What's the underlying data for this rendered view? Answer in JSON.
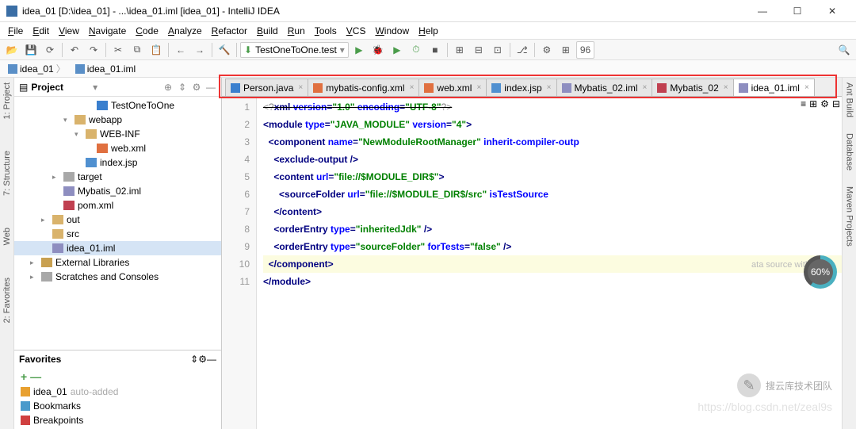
{
  "window": {
    "title": "idea_01 [D:\\idea_01] - ...\\idea_01.iml [idea_01] - IntelliJ IDEA"
  },
  "menu": [
    "File",
    "Edit",
    "View",
    "Navigate",
    "Code",
    "Analyze",
    "Refactor",
    "Build",
    "Run",
    "Tools",
    "VCS",
    "Window",
    "Help"
  ],
  "runConfig": "TestOneToOne.test",
  "breadcrumb": [
    {
      "icon": "module",
      "label": "idea_01"
    },
    {
      "icon": "iml",
      "label": "idea_01.iml"
    }
  ],
  "projectPane": {
    "title": "Project"
  },
  "tree": [
    {
      "d": 4,
      "arr": "",
      "icon": "f-java",
      "label": "TestOneToOne"
    },
    {
      "d": 2,
      "arr": "v",
      "icon": "f-folder",
      "label": "webapp"
    },
    {
      "d": 3,
      "arr": "v",
      "icon": "f-folder",
      "label": "WEB-INF"
    },
    {
      "d": 4,
      "arr": "",
      "icon": "f-xml",
      "label": "web.xml"
    },
    {
      "d": 3,
      "arr": "",
      "icon": "f-jsp",
      "label": "index.jsp"
    },
    {
      "d": 1,
      "arr": ">",
      "icon": "f-folder-g",
      "label": "target"
    },
    {
      "d": 1,
      "arr": "",
      "icon": "f-iml",
      "label": "Mybatis_02.iml"
    },
    {
      "d": 1,
      "arr": "",
      "icon": "f-pom",
      "label": "pom.xml"
    },
    {
      "d": 0,
      "arr": ">",
      "icon": "f-folder",
      "label": "out"
    },
    {
      "d": 0,
      "arr": "",
      "icon": "f-folder",
      "label": "src"
    },
    {
      "d": 0,
      "arr": "",
      "icon": "f-iml",
      "label": "idea_01.iml",
      "sel": true
    },
    {
      "d": -1,
      "arr": ">",
      "icon": "f-lib",
      "label": "External Libraries"
    },
    {
      "d": -1,
      "arr": ">",
      "icon": "f-folder-g",
      "label": "Scratches and Consoles"
    }
  ],
  "favoritesPane": {
    "title": "Favorites"
  },
  "favorites": [
    {
      "icon": "#e8a030",
      "label": "idea_01",
      "suffix": "auto-added"
    },
    {
      "icon": "#4a9acb",
      "label": "Bookmarks",
      "suffix": ""
    },
    {
      "icon": "#d04040",
      "label": "Breakpoints",
      "suffix": ""
    }
  ],
  "tabs": [
    {
      "icon": "f-java",
      "label": "Person.java",
      "active": false
    },
    {
      "icon": "f-xml",
      "label": "mybatis-config.xml",
      "active": false
    },
    {
      "icon": "f-xml",
      "label": "web.xml",
      "active": false
    },
    {
      "icon": "f-jsp",
      "label": "index.jsp",
      "active": false
    },
    {
      "icon": "f-iml",
      "label": "Mybatis_02.iml",
      "active": false
    },
    {
      "icon": "f-pom",
      "label": "Mybatis_02",
      "active": false
    },
    {
      "icon": "f-iml",
      "label": "idea_01.iml",
      "active": true
    }
  ],
  "gutter": [
    "1",
    "2",
    "3",
    "4",
    "5",
    "6",
    "7",
    "8",
    "9",
    "10",
    "11"
  ],
  "code": [
    [
      {
        "c": "t-pi",
        "t": "<?"
      },
      {
        "c": "t-tag",
        "t": "xml "
      },
      {
        "c": "t-attr",
        "t": "version"
      },
      {
        "c": "t-tag",
        "t": "="
      },
      {
        "c": "t-str",
        "t": "\"1.0\" "
      },
      {
        "c": "t-attr",
        "t": "encoding"
      },
      {
        "c": "t-tag",
        "t": "="
      },
      {
        "c": "t-str",
        "t": "\"UTF-8\""
      },
      {
        "c": "t-pi",
        "t": "?>"
      }
    ],
    [
      {
        "c": "t-tag",
        "t": "<module "
      },
      {
        "c": "t-attr",
        "t": "type"
      },
      {
        "c": "t-tag",
        "t": "="
      },
      {
        "c": "t-str",
        "t": "\"JAVA_MODULE\" "
      },
      {
        "c": "t-attr",
        "t": "version"
      },
      {
        "c": "t-tag",
        "t": "="
      },
      {
        "c": "t-str",
        "t": "\"4\""
      },
      {
        "c": "t-tag",
        "t": ">"
      }
    ],
    [
      {
        "c": "",
        "t": "  "
      },
      {
        "c": "t-tag",
        "t": "<component "
      },
      {
        "c": "t-attr",
        "t": "name"
      },
      {
        "c": "t-tag",
        "t": "="
      },
      {
        "c": "t-str",
        "t": "\"NewModuleRootManager\" "
      },
      {
        "c": "t-attr",
        "t": "inherit-compiler-outp"
      }
    ],
    [
      {
        "c": "",
        "t": "    "
      },
      {
        "c": "t-tag",
        "t": "<exclude-output />"
      }
    ],
    [
      {
        "c": "",
        "t": "    "
      },
      {
        "c": "t-tag",
        "t": "<content "
      },
      {
        "c": "t-attr",
        "t": "url"
      },
      {
        "c": "t-tag",
        "t": "="
      },
      {
        "c": "t-str",
        "t": "\"file://$MODULE_DIR$\""
      },
      {
        "c": "t-tag",
        "t": ">"
      }
    ],
    [
      {
        "c": "",
        "t": "      "
      },
      {
        "c": "t-tag",
        "t": "<sourceFolder "
      },
      {
        "c": "t-attr",
        "t": "url"
      },
      {
        "c": "t-tag",
        "t": "="
      },
      {
        "c": "t-str",
        "t": "\"file://$MODULE_DIR$/src\" "
      },
      {
        "c": "t-attr",
        "t": "isTestSource"
      }
    ],
    [
      {
        "c": "",
        "t": "    "
      },
      {
        "c": "t-tag",
        "t": "</content>"
      }
    ],
    [
      {
        "c": "",
        "t": "    "
      },
      {
        "c": "t-tag",
        "t": "<orderEntry "
      },
      {
        "c": "t-attr",
        "t": "type"
      },
      {
        "c": "t-tag",
        "t": "="
      },
      {
        "c": "t-str",
        "t": "\"inheritedJdk\" "
      },
      {
        "c": "t-tag",
        "t": "/>"
      }
    ],
    [
      {
        "c": "",
        "t": "    "
      },
      {
        "c": "t-tag",
        "t": "<orderEntry "
      },
      {
        "c": "t-attr",
        "t": "type"
      },
      {
        "c": "t-tag",
        "t": "="
      },
      {
        "c": "t-str",
        "t": "\"sourceFolder\" "
      },
      {
        "c": "t-attr",
        "t": "forTests"
      },
      {
        "c": "t-tag",
        "t": "="
      },
      {
        "c": "t-str",
        "t": "\"false\" "
      },
      {
        "c": "t-tag",
        "t": "/>"
      }
    ],
    [
      {
        "c": "",
        "t": "  "
      },
      {
        "c": "t-tag",
        "t": "</component>"
      }
    ],
    [
      {
        "c": "t-tag",
        "t": "</module>"
      }
    ]
  ],
  "codeHighlight": 9,
  "sideLeft": [
    "1: Project",
    "7: Structure",
    "Web",
    "2: Favorites"
  ],
  "sideRight": [
    "Ant Build",
    "Database",
    "Maven Projects"
  ],
  "ghostText": "ata source with",
  "progress": "60%",
  "watermark": "搜云库技术团队",
  "urlWatermark": "https://blog.csdn.net/zeal9s"
}
